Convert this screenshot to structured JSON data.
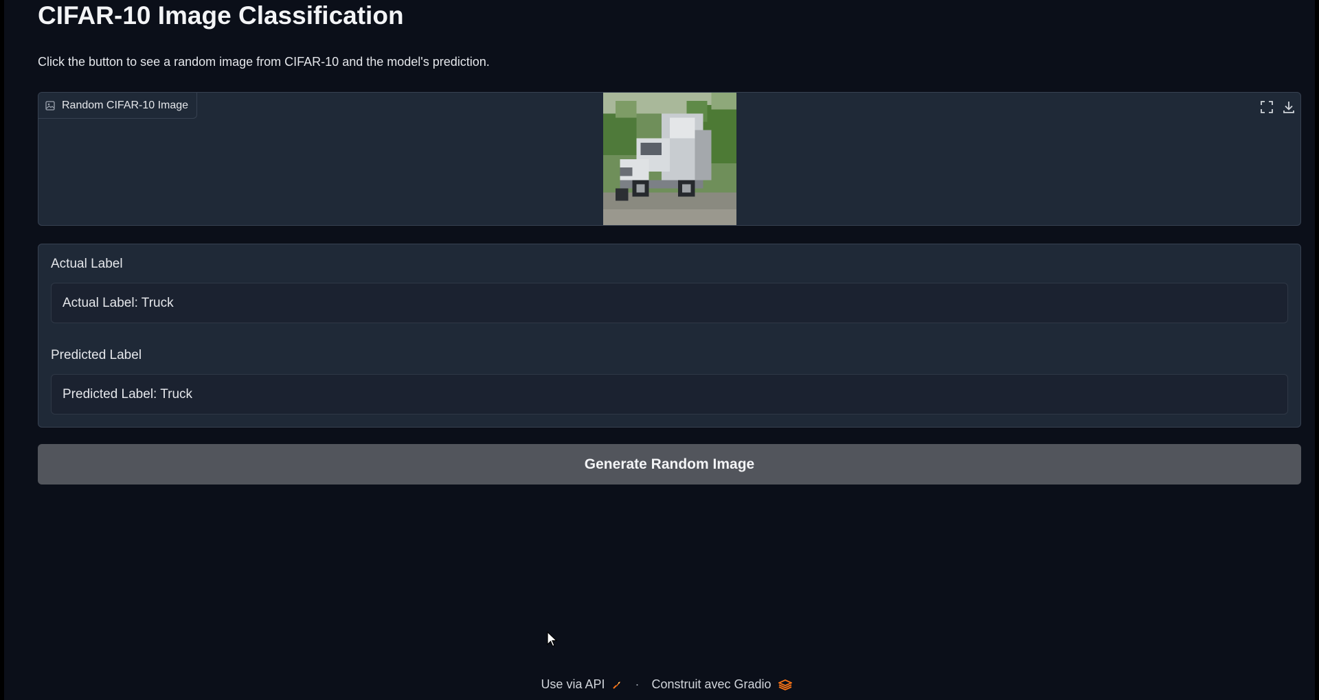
{
  "header": {
    "title": "CIFAR-10 Image Classification",
    "description": "Click the button to see a random image from CIFAR-10 and the model's prediction."
  },
  "image_panel": {
    "label": "Random CIFAR-10 Image",
    "fullscreen_icon": "fullscreen-icon",
    "download_icon": "download-icon",
    "image_icon": "image-icon"
  },
  "actual": {
    "label": "Actual Label",
    "value": "Actual Label: Truck"
  },
  "predicted": {
    "label": "Predicted Label",
    "value": "Predicted Label: Truck"
  },
  "button": {
    "label": "Generate Random Image"
  },
  "footer": {
    "api_link": "Use via API",
    "separator": "·",
    "built_with": "Construit avec Gradio",
    "rocket_icon": "rocket-icon",
    "gradio_logo": "gradio-logo-icon"
  },
  "colors": {
    "background": "#0b0f19",
    "panel": "#1f2937",
    "button": "#52555c",
    "accent": "#f97316"
  }
}
